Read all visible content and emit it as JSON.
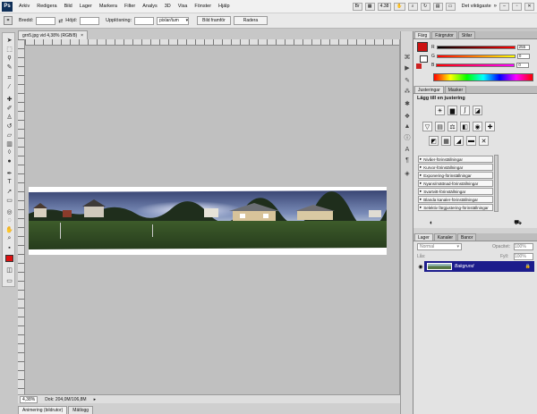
{
  "app": {
    "logo": "Ps",
    "menu": [
      "Arkiv",
      "Redigera",
      "Bild",
      "Lager",
      "Markera",
      "Filter",
      "Analys",
      "3D",
      "Visa",
      "Fönster",
      "Hjälp"
    ],
    "zoom_menu": "4.38",
    "workspace": "Det viktigaste"
  },
  "options_bar": {
    "width_label": "Bredd:",
    "height_label": "Höjd:",
    "resolution_label": "Upplösning:",
    "resolution_unit": "pixlar/tum",
    "front_image_button": "Bild framför",
    "clear_button": "Radera"
  },
  "document": {
    "tab_title": "grn5.jpg vid 4,38% (RGB/8)",
    "tab_close": "×",
    "zoom": "4,38%",
    "doc_info": "Dok: 204,0M/106,8M"
  },
  "bottom_tabs": [
    "Animering (bildrutor)",
    "Mätlogg"
  ],
  "color_panel": {
    "tabs": [
      "Färg",
      "Färgrutor",
      "Stilar"
    ],
    "fg_color": "#cc1111",
    "rows": [
      {
        "letter": "R",
        "value": "255"
      },
      {
        "letter": "G",
        "value": "0"
      },
      {
        "letter": "B",
        "value": "0"
      }
    ]
  },
  "adjustments_panel": {
    "tabs": [
      "Justeringar",
      "Masker"
    ],
    "heading": "Lägg till en justering",
    "presets": [
      "Nivåer-förinställningar",
      "Kurvor-förinställningar",
      "Exponering-förinställningar",
      "Nyans/mättnad-förinställningar",
      "Svartvitt-förinställningar",
      "Blanda kanaler-förinställningar",
      "Selektiv färgjustering-förinställningar"
    ]
  },
  "layers_panel": {
    "tabs": [
      "Lager",
      "Kanaler",
      "Banor"
    ],
    "blend_mode": "Normal",
    "opacity_label": "Opacitet:",
    "opacity_value": "100%",
    "lock_label": "Lås:",
    "fill_label": "Fyll:",
    "fill_value": "100%",
    "layer_name": "Bakgrund"
  }
}
